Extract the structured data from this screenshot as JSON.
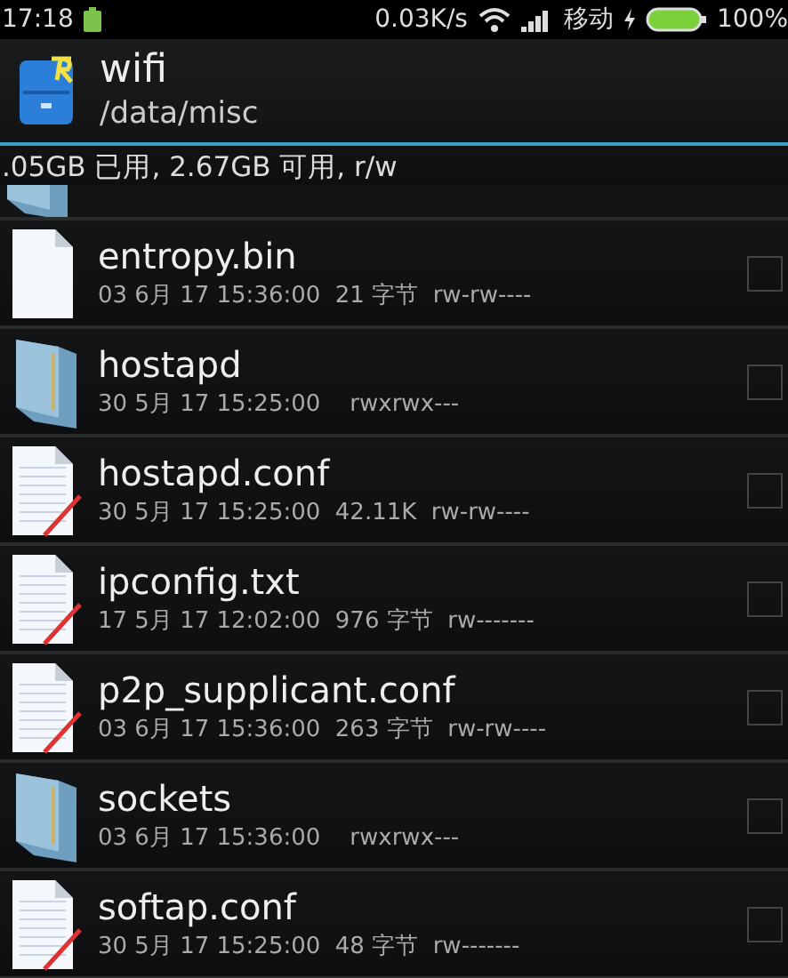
{
  "status_bar": {
    "time": "17:18",
    "speed": "0.03K/s",
    "carrier": "移动",
    "battery": "100%"
  },
  "header": {
    "title": "wifi",
    "path": "/data/misc"
  },
  "storage": ".05GB 已用, 2.67GB 可用, r/w",
  "files": [
    {
      "kind": "file",
      "name": "entropy.bin",
      "meta": "03 6月 17 15:36:00  21 字节  rw-rw----",
      "checked": false
    },
    {
      "kind": "folder",
      "name": "hostapd",
      "meta": "30 5月 17 15:25:00    rwxrwx---",
      "checked": false
    },
    {
      "kind": "text",
      "name": "hostapd.conf",
      "meta": "30 5月 17 15:25:00  42.11K  rw-rw----",
      "checked": false
    },
    {
      "kind": "text",
      "name": "ipconfig.txt",
      "meta": "17 5月 17 12:02:00  976 字节  rw-------",
      "checked": false
    },
    {
      "kind": "text",
      "name": "p2p_supplicant.conf",
      "meta": "03 6月 17 15:36:00  263 字节  rw-rw----",
      "checked": false
    },
    {
      "kind": "folder",
      "name": "sockets",
      "meta": "03 6月 17 15:36:00    rwxrwx---",
      "checked": false
    },
    {
      "kind": "text",
      "name": "softap.conf",
      "meta": "30 5月 17 15:25:00  48 字节  rw-------",
      "checked": false
    }
  ]
}
